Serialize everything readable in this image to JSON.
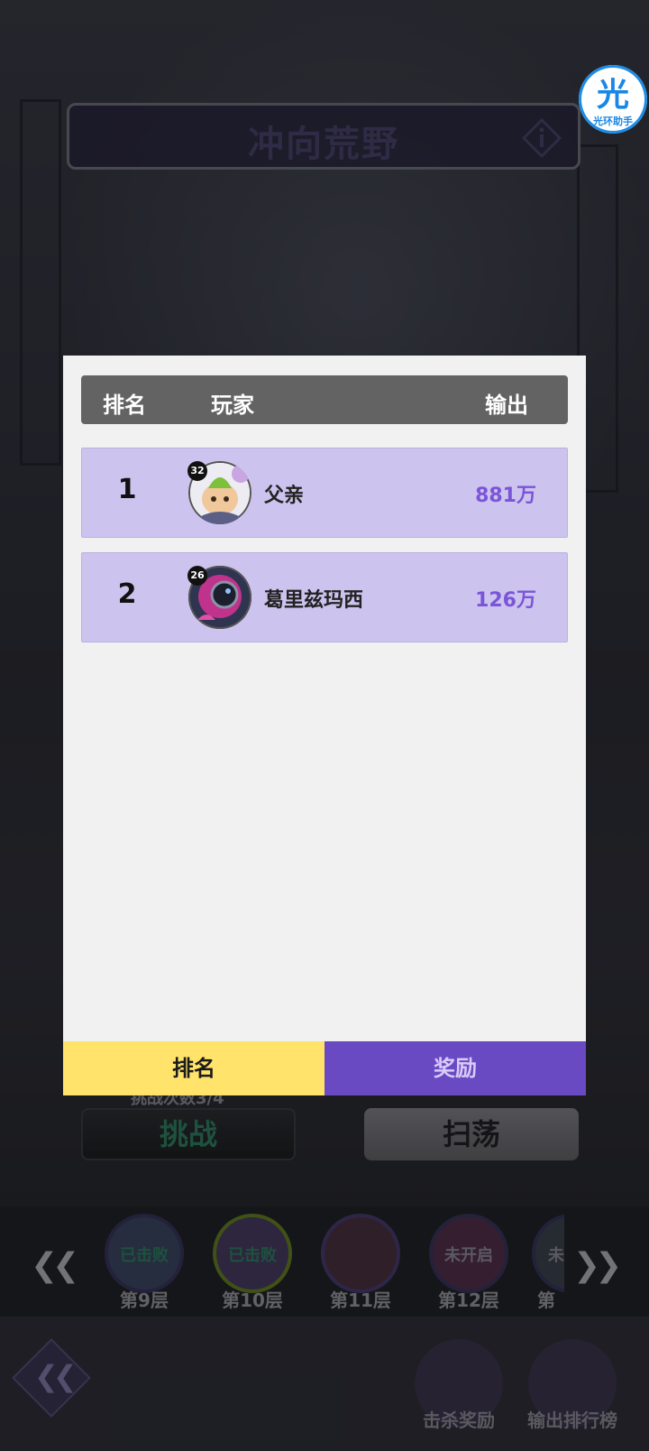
{
  "event_title": "冲向荒野",
  "helper_badge": {
    "glyph": "光",
    "label": "光环助手"
  },
  "ranking_table": {
    "headers": {
      "rank": "排名",
      "player": "玩家",
      "damage": "输出"
    },
    "rows": [
      {
        "rank": "1",
        "level": "32",
        "name": "父亲",
        "damage": "881万",
        "avatar_icon": "green-hair-character-avatar"
      },
      {
        "rank": "2",
        "level": "26",
        "name": "葛里兹玛西",
        "damage": "126万",
        "avatar_icon": "pink-diver-helmet-avatar"
      }
    ]
  },
  "tabs": {
    "rank": "排名",
    "reward": "奖励"
  },
  "attempts_text": "挑战次数3/4",
  "buttons": {
    "challenge": "挑战",
    "sweep": "扫荡"
  },
  "floors": [
    {
      "state": "已击败",
      "name": "第9层"
    },
    {
      "state": "已击败",
      "name": "第10层"
    },
    {
      "state": "",
      "name": "第11层"
    },
    {
      "state": "未开启",
      "name": "第12层"
    },
    {
      "state": "未",
      "name": "第"
    }
  ],
  "bottom_actions": {
    "kill_reward": "击杀奖励",
    "damage_ranking": "输出排行榜"
  },
  "colors": {
    "row_bg": "#cdc3ef",
    "damage_text": "#7a55d8",
    "tab_active": "#ffe36a",
    "tab_inactive": "#6a4ac2"
  }
}
